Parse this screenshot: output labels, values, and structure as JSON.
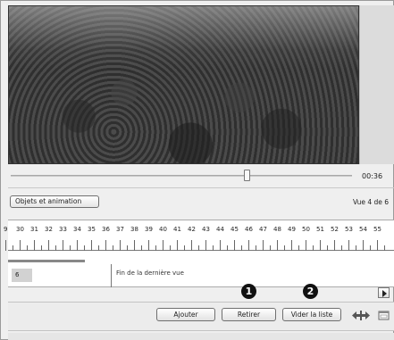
{
  "player": {
    "time": "00:36",
    "progress": 0.69
  },
  "tab": {
    "objects_animation_label": "Objets et animation"
  },
  "view_counter": "Vue 4 de 6",
  "timeline": {
    "ruler_numbers": [
      "9",
      "30",
      "31",
      "32",
      "33",
      "34",
      "35",
      "36",
      "37",
      "38",
      "39",
      "40",
      "41",
      "42",
      "43",
      "44",
      "45",
      "46",
      "47",
      "48",
      "49",
      "50",
      "51",
      "52",
      "53",
      "54",
      "55"
    ],
    "slide_number": "6",
    "end_label": "Fin de la dernière vue"
  },
  "buttons": {
    "add": "Ajouter",
    "remove": "Retirer",
    "clear": "Vider la liste"
  },
  "badges": {
    "first": "1",
    "second": "2"
  },
  "icons": {
    "scroll_right": "chevron-right-icon",
    "move": "move-arrows-icon",
    "window": "window-icon"
  }
}
